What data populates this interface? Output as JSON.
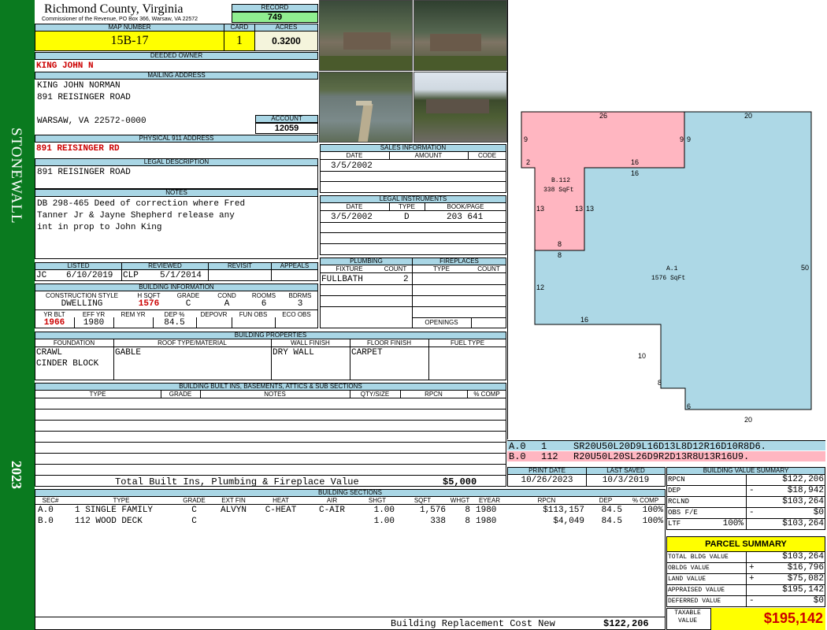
{
  "sidebar": {
    "district": "STONEWALL",
    "year": "2023",
    "color": "#0a7a1f"
  },
  "header": {
    "county": "Richmond County, Virginia",
    "commissioner": "Commissioner of the Revenue, PO Box 366, Warsaw, VA 22572",
    "record_label": "RECORD",
    "record": "749",
    "map_number_label": "MAP NUMBER",
    "map_number": "15B-17",
    "card_label": "CARD",
    "card": "1",
    "acres_label": "ACRES",
    "acres": "0.3200"
  },
  "owner": {
    "deeded_label": "DEEDED OWNER",
    "deeded": "KING JOHN N",
    "mailing_label": "MAILING ADDRESS",
    "mailing": [
      "KING JOHN NORMAN",
      "891 REISINGER ROAD",
      "",
      "WARSAW, VA 22572-0000"
    ],
    "account_label": "ACCOUNT",
    "account": "12059",
    "physical_label": "PHYSICAL 911 ADDRESS",
    "physical": "891 REISINGER RD",
    "legal_label": "LEGAL DESCRIPTION",
    "legal": "891 REISINGER ROAD",
    "notes_label": "NOTES",
    "notes": [
      "DB 298-465 Deed of correction where Fred",
      "Tanner Jr & Jayne Shepherd release any",
      "int in prop to John King"
    ]
  },
  "sales": {
    "title": "SALES INFORMATION",
    "cols": [
      "DATE",
      "AMOUNT",
      "CODE"
    ],
    "rows": [
      {
        "date": "3/5/2002",
        "amount": "",
        "code": ""
      }
    ]
  },
  "legal_instruments": {
    "title": "LEGAL INSTRUMENTS",
    "cols": [
      "DATE",
      "TYPE",
      "BOOK/PAGE"
    ],
    "rows": [
      {
        "date": "3/5/2002",
        "type": "D",
        "book": "203 641"
      }
    ]
  },
  "listing": {
    "listed_label": "LISTED",
    "listed_by": "JC",
    "listed_date": "6/10/2019",
    "reviewed_label": "REVIEWED",
    "reviewed_by": "CLP",
    "reviewed_date": "5/1/2014",
    "revisit_label": "REVISIT",
    "appeals_label": "APPEALS"
  },
  "building_info": {
    "title": "BUILDING INFORMATION",
    "cols1": [
      "CONSTRUCTION STYLE",
      "H SQFT",
      "GRADE",
      "COND",
      "ROOMS",
      "BDRMS"
    ],
    "style": "DWELLING",
    "hsqft": "1576",
    "grade": "C",
    "cond": "A",
    "rooms": "6",
    "bdrms": "3",
    "cols2": [
      "YR BLT",
      "EFF YR",
      "REM YR",
      "DEP %",
      "DEPOVR",
      "FUN OBS",
      "ECO OBS"
    ],
    "yr_blt": "1966",
    "eff_yr": "1980",
    "rem_yr": "",
    "dep": "84.5"
  },
  "plumbing": {
    "title": "PLUMBING",
    "cols": [
      "FIXTURE",
      "COUNT"
    ],
    "fixture": "FULLBATH",
    "count": "2"
  },
  "fireplaces": {
    "title": "FIREPLACES",
    "cols": [
      "TYPE",
      "COUNT"
    ],
    "openings_label": "OPENINGS"
  },
  "properties": {
    "title": "BUILDING PROPERTIES",
    "cols": [
      "FOUNDATION",
      "ROOF TYPE/MATERIAL",
      "WALL FINISH",
      "FLOOR FINISH",
      "FUEL TYPE"
    ],
    "foundation": [
      "CRAWL",
      "CINDER BLOCK"
    ],
    "roof": "GABLE",
    "wall": "DRY WALL",
    "floor": "CARPET",
    "fuel": ""
  },
  "builtins": {
    "title": "BUILDING BUILT INS, BASEMENTS, ATTICS & SUB SECTIONS",
    "cols": [
      "TYPE",
      "GRADE",
      "NOTES",
      "QTY/SIZE",
      "RPCN",
      "% COMP"
    ],
    "total_label": "Total Built Ins, Plumbing & Fireplace Value",
    "total": "$5,000"
  },
  "dates": {
    "print_label": "PRINT DATE",
    "print": "10/26/2023",
    "saved_label": "LAST SAVED",
    "saved": "10/3/2019"
  },
  "sections": {
    "title": "BUILDING SECTIONS",
    "cols": [
      "SEC#",
      "TYPE",
      "GRADE",
      "EXT FIN",
      "HEAT",
      "AIR",
      "SHGT",
      "SQFT",
      "WHGT",
      "EYEAR",
      "RPCN",
      "DEP",
      "% COMP"
    ],
    "rows": [
      {
        "sec": "A.0",
        "type": "1 SINGLE FAMILY",
        "grade": "C",
        "ext": "ALVYN",
        "heat": "C-HEAT",
        "air": "C-AIR",
        "shgt": "1.00",
        "sqft": "1,576",
        "whgt": "8",
        "eyear": "1980",
        "rpcn": "$113,157",
        "dep": "84.5",
        "comp": "100%"
      },
      {
        "sec": "B.0",
        "type": "112 WOOD DECK",
        "grade": "C",
        "ext": "",
        "heat": "",
        "air": "",
        "shgt": "1.00",
        "sqft": "338",
        "whgt": "8",
        "eyear": "1980",
        "rpcn": "$4,049",
        "dep": "84.5",
        "comp": "100%"
      }
    ],
    "replacement_label": "Building Replacement Cost New",
    "replacement": "$122,206"
  },
  "sketch": {
    "areas": [
      {
        "label": "B.112",
        "sqft": "338 SqFt",
        "color": "#ffb6c1"
      },
      {
        "label": "A.1",
        "sqft": "1576 SqFt",
        "color": "#add8e6"
      }
    ],
    "dims": [
      "26",
      "20",
      "9",
      "9",
      "9",
      "2",
      "16",
      "16",
      "13",
      "13",
      "13",
      "8",
      "8",
      "50",
      "12",
      "16",
      "10",
      "8",
      "6",
      "20"
    ],
    "vectors": [
      {
        "sec": "A.0",
        "num": "1",
        "path": "SR20U50L20D9L16D13L8D12R16D10R8D6.",
        "color": "#add8e6"
      },
      {
        "sec": "B.0",
        "num": "112",
        "path": "R20U50L20SL26D9R2D13R8U13R16U9.",
        "color": "#ffb6c1"
      }
    ]
  },
  "value_summary": {
    "title": "BUILDING VALUE SUMMARY",
    "rows": [
      {
        "label": "RPCN",
        "sign": "",
        "pct": "",
        "value": "$122,206"
      },
      {
        "label": "DEP",
        "sign": "-",
        "pct": "",
        "value": "$18,942"
      },
      {
        "label": "RCLND",
        "sign": "",
        "pct": "",
        "value": "$103,264"
      },
      {
        "label": "OBS F/E",
        "sign": "-",
        "pct": "",
        "value": "$0"
      },
      {
        "label": "LTF",
        "sign": "",
        "pct": "100%",
        "value": "$103,264"
      }
    ]
  },
  "parcel": {
    "title": "PARCEL SUMMARY",
    "rows": [
      {
        "label": "TOTAL BLDG VALUE",
        "sign": "",
        "value": "$103,264"
      },
      {
        "label": "OBLDG VALUE",
        "sign": "+",
        "value": "$16,796"
      },
      {
        "label": "LAND VALUE",
        "sign": "+",
        "value": "$75,082"
      },
      {
        "label": "APPRAISED VALUE",
        "sign": "",
        "value": "$195,142"
      },
      {
        "label": "DEFERRED VALUE",
        "sign": "-",
        "value": "$0"
      }
    ],
    "taxable_label": "TAXABLE VALUE",
    "taxable": "$195,142"
  }
}
